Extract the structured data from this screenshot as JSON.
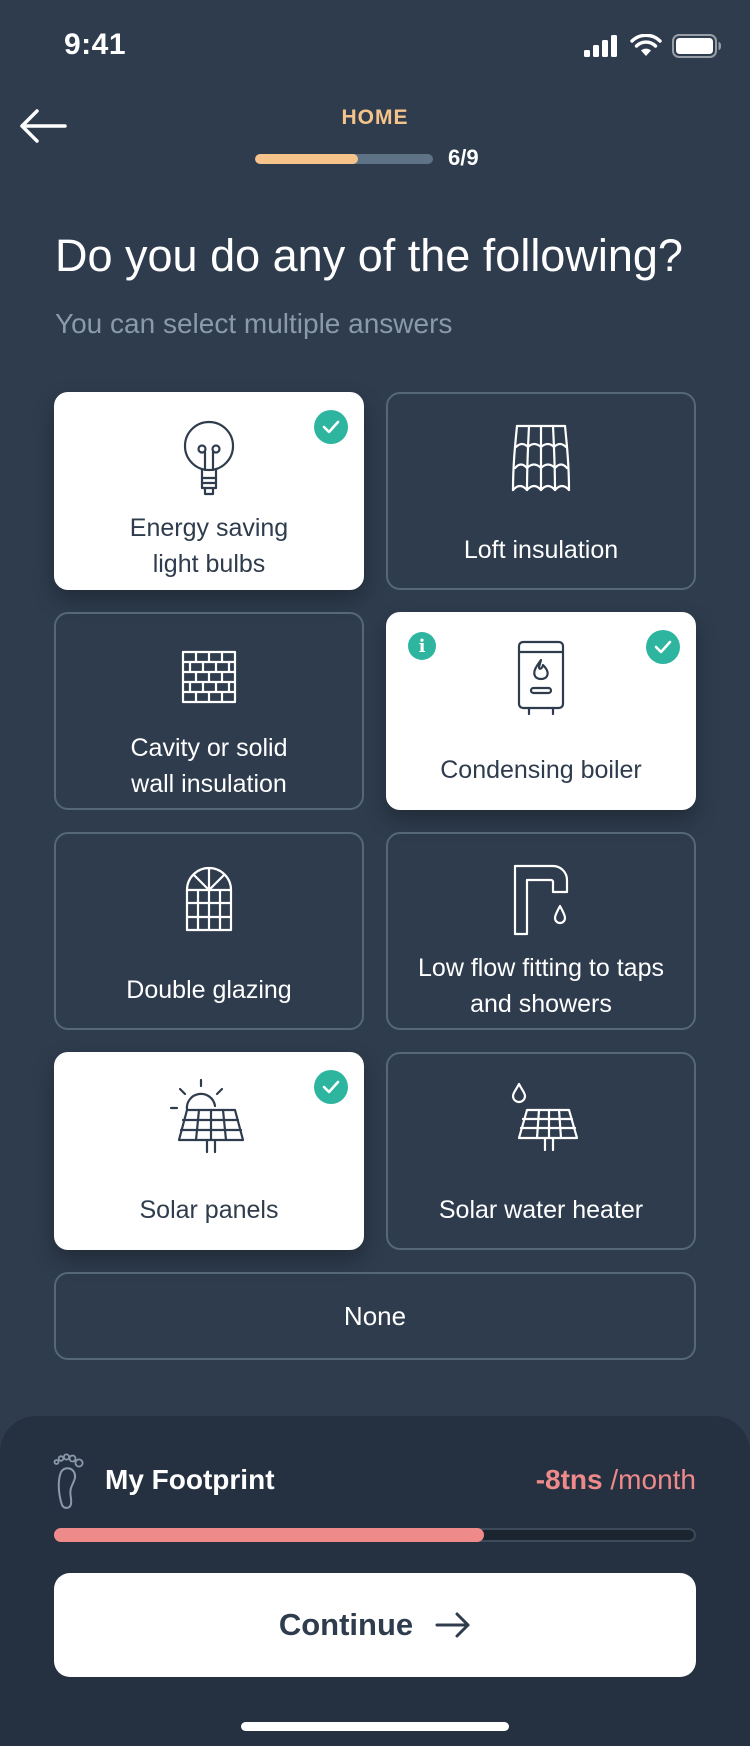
{
  "status_bar": {
    "time": "9:41"
  },
  "header": {
    "step_label": "HOME",
    "step_count": "6/9",
    "progress_fraction": 0.58
  },
  "question": {
    "title": "Do you do any of the following?",
    "subtitle": "You can select multiple answers"
  },
  "options": [
    {
      "label": "Energy saving\nlight bulbs",
      "icon": "light-bulb-icon",
      "selected": true
    },
    {
      "label": "Loft insulation",
      "icon": "roof-tiles-icon",
      "selected": false
    },
    {
      "label": "Cavity or solid\nwall insulation",
      "icon": "brick-wall-icon",
      "selected": false
    },
    {
      "label": "Condensing boiler",
      "icon": "boiler-icon",
      "selected": true,
      "info": true
    },
    {
      "label": "Double glazing",
      "icon": "window-icon",
      "selected": false
    },
    {
      "label": "Low flow fitting to taps\nand showers",
      "icon": "tap-icon",
      "selected": false
    },
    {
      "label": "Solar panels",
      "icon": "solar-panel-icon",
      "selected": true
    },
    {
      "label": "Solar water heater",
      "icon": "solar-water-heater-icon",
      "selected": false
    }
  ],
  "none_option": {
    "label": "None"
  },
  "footprint": {
    "label": "My Footprint",
    "value": "-8tns",
    "unit": " /month",
    "bar_fraction": 0.67
  },
  "continue_button": {
    "label": "Continue"
  },
  "colors": {
    "background": "#2e3c4d",
    "accent_orange": "#f6c48a",
    "accent_red": "#ee8a8a",
    "check_teal": "#2db5a0",
    "text_dark": "#2e3c4d"
  }
}
